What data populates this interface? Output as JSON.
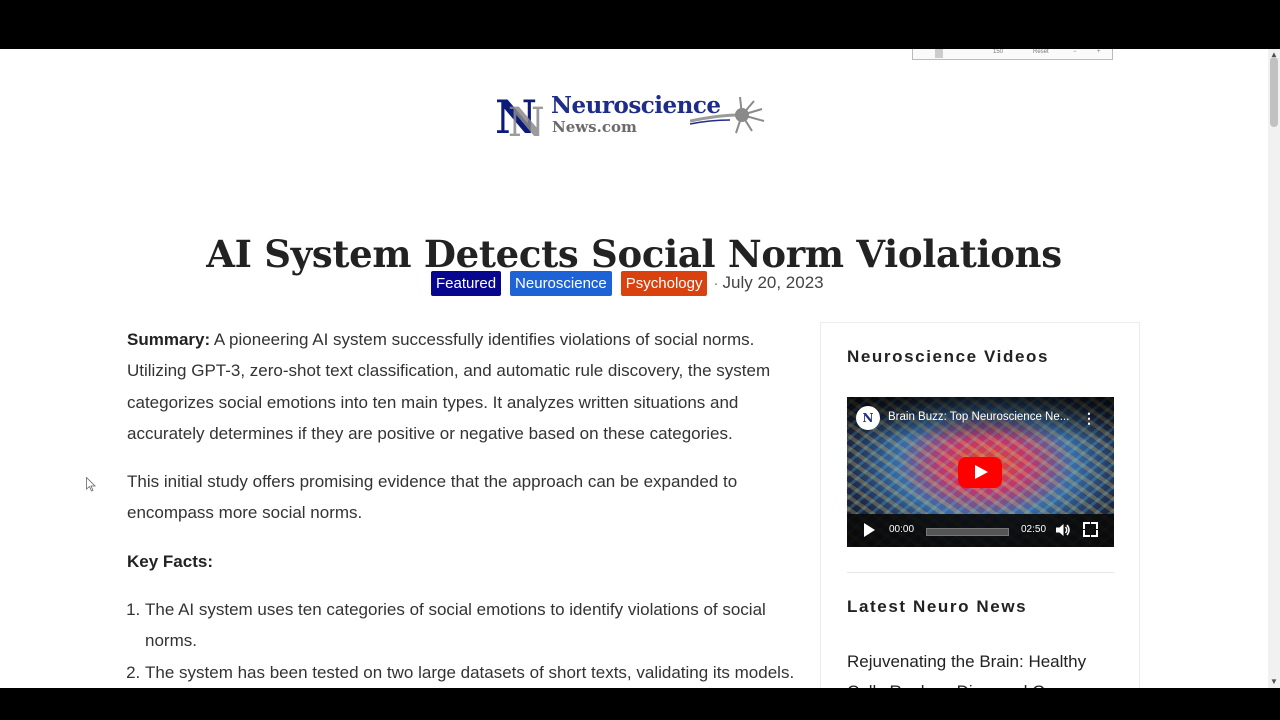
{
  "toolbar": {
    "zoom": "150",
    "reset": "Reset",
    "minus": "−",
    "plus": "+"
  },
  "logo": {
    "mark": "N",
    "line1": "Neuroscience",
    "line2": "News.com"
  },
  "article": {
    "title": "AI System Detects Social Norm Violations",
    "tags": [
      "Featured",
      "Neuroscience",
      "Psychology"
    ],
    "separator": "·",
    "date": "July 20, 2023",
    "summary_label": "Summary:",
    "summary_text": " A pioneering AI system successfully identifies violations of social norms. Utilizing GPT-3, zero-shot text classification, and automatic rule discovery, the system categorizes social emotions into ten main types. It analyzes written situations and accurately determines if they are positive or negative based on these categories.",
    "paragraph2": "This initial study offers promising evidence that the approach can be expanded to encompass more social norms.",
    "key_facts_label": "Key Facts:",
    "key_facts": [
      "The AI system uses ten categories of social emotions to identify violations of social norms.",
      "The system has been tested on two large datasets of short texts, validating its models."
    ]
  },
  "sidebar": {
    "videos_title": "Neuroscience Videos",
    "video": {
      "channel_mark": "N",
      "title": "Brain Buzz: Top Neuroscience Ne...",
      "current_time": "00:00",
      "duration": "02:50",
      "progress": 0
    },
    "news_title": "Latest Neuro News",
    "news_items": [
      "Rejuvenating the Brain: Healthy Cells Replace Diseased Ones"
    ]
  }
}
